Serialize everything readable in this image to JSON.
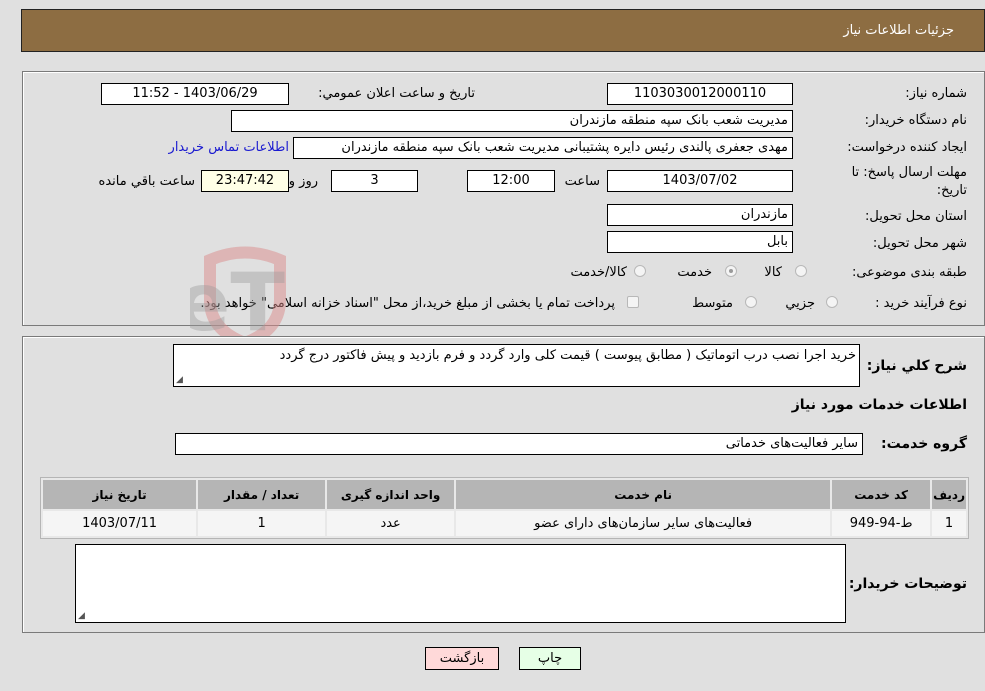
{
  "header": {
    "title": "جزئيات اطلاعات نياز"
  },
  "form": {
    "need_number": {
      "label": "شماره نیاز:",
      "value": "1103030012000110"
    },
    "announce_datetime": {
      "label": "تاريخ و ساعت اعلان عمومي:",
      "value": "1403/06/29 - 11:52"
    },
    "buyer_org": {
      "label": "نام دستگاه خریدار:",
      "value": "مدیریت شعب بانک سپه منطقه مازندران"
    },
    "requester": {
      "label": "ایجاد کننده درخواست:",
      "value": "مهدی جعفری پالندی رئیس دایره پشتیبانی مدیریت شعب بانک سپه منطقه مازندران",
      "contact_link": "اطلاعات تماس خریدار"
    },
    "deadline": {
      "label": "مهلت ارسال پاسخ: تا تاریخ:",
      "date": "1403/07/02",
      "time_label": "ساعت",
      "time": "12:00",
      "days": "3",
      "days_label": "روز و",
      "remaining": "23:47:42",
      "remaining_label": "ساعت باقي مانده"
    },
    "province": {
      "label": "استان محل تحویل:",
      "value": "مازندران"
    },
    "city": {
      "label": "شهر محل تحویل:",
      "value": "بابل"
    },
    "category": {
      "label": "طبقه بندی موضوعی:",
      "options": [
        {
          "label": "کالا",
          "selected": false
        },
        {
          "label": "خدمت",
          "selected": true
        },
        {
          "label": "کالا/خدمت",
          "selected": false
        }
      ]
    },
    "process": {
      "label": "نوع فرآیند خرید :",
      "options": [
        {
          "label": "جزيي",
          "selected": false
        },
        {
          "label": "متوسط",
          "selected": false
        }
      ],
      "treasury_note": "پرداخت تمام یا بخشی از مبلغ خرید،از محل \"اسناد خزانه اسلامی\" خواهد بود."
    }
  },
  "details": {
    "description_label": "شرح كلي نياز:",
    "description": "خرید اجرا نصب درب اتوماتیک ( مطابق پیوست ) قیمت کلی وارد گردد و فرم بازدید و پیش فاکتور درج گردد",
    "services_heading": "اطلاعات خدمات مورد نياز",
    "service_group_label": "گروه خدمت:",
    "service_group": "سایر فعالیت‌های خدماتی",
    "table": {
      "headers": [
        "رديف",
        "کد خدمت",
        "نام خدمت",
        "واحد اندازه گیری",
        "تعداد / مقدار",
        "تاریخ نیاز"
      ],
      "rows": [
        [
          "1",
          "ط-94-949",
          "فعالیت‌های سایر سازمان‌های دارای عضو",
          "عدد",
          "1",
          "1403/07/11"
        ]
      ]
    },
    "buyer_notes_label": "توضیحات خریدار:",
    "buyer_notes": ""
  },
  "buttons": {
    "print": "چاپ",
    "back": "بازگشت"
  },
  "watermark": {
    "text": "AriaTender.neT"
  }
}
